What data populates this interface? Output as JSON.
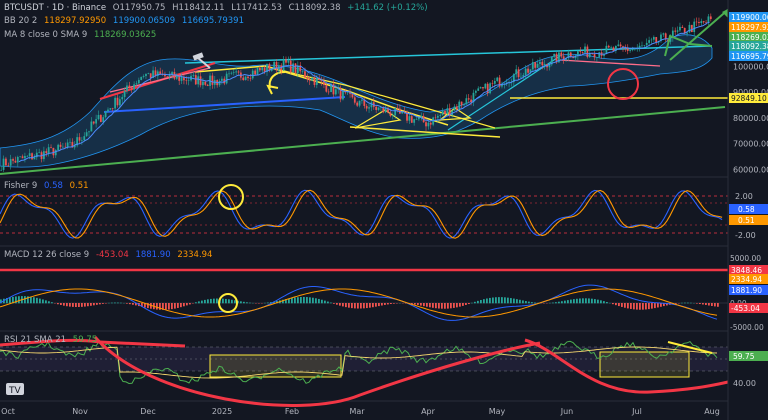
{
  "header": {
    "symbol": "BTCUSDT · 1D · Binance",
    "open": "O117950.75",
    "high": "H118412.11",
    "low": "L117412.53",
    "close": "C118092.38",
    "change": "+141.62 (+0.12%)"
  },
  "bb": {
    "label": "BB 20 2",
    "basis": "118297.92950",
    "upper": "119900.06509",
    "lower": "116695.79391"
  },
  "ma": {
    "label": "MA 8 close 0 SMA 9",
    "value": "118269.03625"
  },
  "fisher": {
    "label": "Fisher 9",
    "v1": "0.58",
    "v2": "0.51"
  },
  "macd": {
    "label": "MACD 12 26 close 9",
    "hist": "-453.04",
    "macd": "1881.90",
    "signal": "2334.94"
  },
  "rsi": {
    "label": "RSI 21 SMA 21",
    "value": "59.75"
  },
  "colors": {
    "background": "#131722",
    "price_line": "#2962ff",
    "bb_band": "#2196f3",
    "red": "#f23645",
    "green": "#4caf50",
    "yellow": "#ffeb3b",
    "cyan": "#00bcd4",
    "pink": "#ff4d8d"
  },
  "chart_data": [
    {
      "type": "line",
      "pane": "price",
      "x": [
        "Oct",
        "Nov",
        "Dec",
        "2025",
        "Feb",
        "Mar",
        "Apr",
        "May",
        "Jun",
        "Jul",
        "Aug"
      ],
      "series": [
        {
          "values": [
            62000,
            69000,
            97000,
            94000,
            101000,
            86000,
            78000,
            94000,
            105000,
            107000,
            118092
          ]
        }
      ],
      "yticks": [
        60000,
        70000,
        80000,
        90000,
        100000
      ],
      "ylim": [
        57000,
        125000
      ],
      "price_labels": [
        "119900.06",
        "118297.92",
        "118269.03",
        "118092.38",
        "116695.79",
        "92849.10"
      ]
    },
    {
      "type": "line",
      "pane": "fisher",
      "series": [
        {
          "values": [
            0.58
          ]
        },
        {
          "values": [
            0.51
          ]
        }
      ],
      "yticks": [
        "2.00",
        "-2.00"
      ],
      "price_labels": [
        "0.58",
        "0.51"
      ]
    },
    {
      "type": "bar",
      "pane": "macd",
      "yticks": [
        "5000.00",
        "0.00",
        "-5000.00"
      ],
      "price_labels": [
        "3848.46",
        "2334.94",
        "1881.90",
        "-453.04"
      ]
    },
    {
      "type": "line",
      "pane": "rsi",
      "series": [
        {
          "values": [
            59.75
          ]
        }
      ],
      "yticks": [
        "40.00"
      ],
      "price_labels": [
        "59.75"
      ]
    }
  ]
}
